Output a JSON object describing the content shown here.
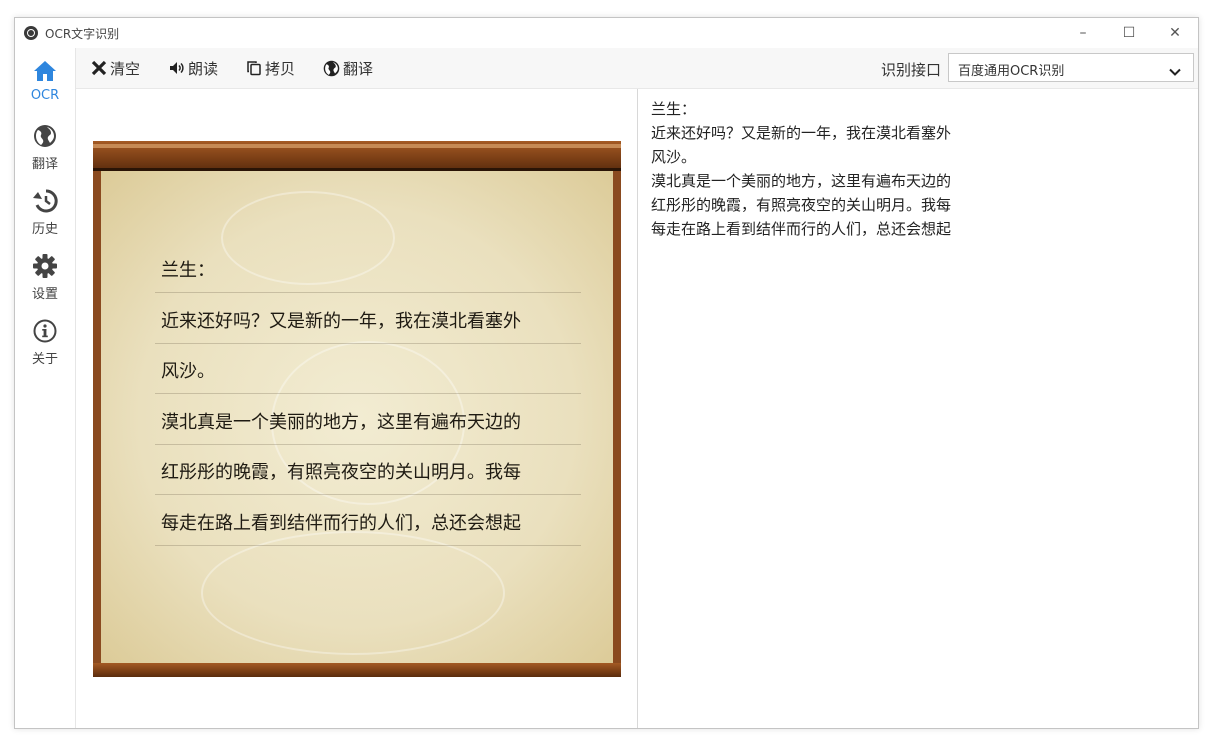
{
  "window": {
    "title": "OCR文字识别",
    "controls": {
      "minimize": "–",
      "maximize": "☐",
      "close": "✕"
    }
  },
  "sidebar": {
    "items": [
      {
        "label": "OCR",
        "icon": "home-icon",
        "active": true
      },
      {
        "label": "翻译",
        "icon": "globe-icon",
        "active": false
      },
      {
        "label": "历史",
        "icon": "history-icon",
        "active": false
      },
      {
        "label": "设置",
        "icon": "gear-icon",
        "active": false
      },
      {
        "label": "关于",
        "icon": "info-icon",
        "active": false
      }
    ]
  },
  "toolbar": {
    "clear_label": "清空",
    "read_label": "朗读",
    "copy_label": "拷贝",
    "translate_label": "翻译",
    "interface_label": "识别接口",
    "interface_value": "百度通用OCR识别"
  },
  "image_text": {
    "lines": [
      "兰生：",
      "近来还好吗？又是新的一年，我在漠北看塞外",
      "风沙。",
      "漠北真是一个美丽的地方，这里有遍布天边的",
      "红彤彤的晚霞，有照亮夜空的关山明月。我每",
      "每走在路上看到结伴而行的人们，总还会想起"
    ]
  },
  "result": {
    "lines": [
      "兰生：",
      "近来还好吗？又是新的一年，我在漠北看塞外",
      "风沙。",
      "漠北真是一个美丽的地方，这里有遍布天边的",
      "红彤彤的晚霞，有照亮夜空的关山明月。我每",
      "每走在路上看到结伴而行的人们，总还会想起"
    ]
  },
  "colors": {
    "accent": "#2e86de",
    "toolbar_bg": "#f7f7f7",
    "text": "#333333"
  }
}
